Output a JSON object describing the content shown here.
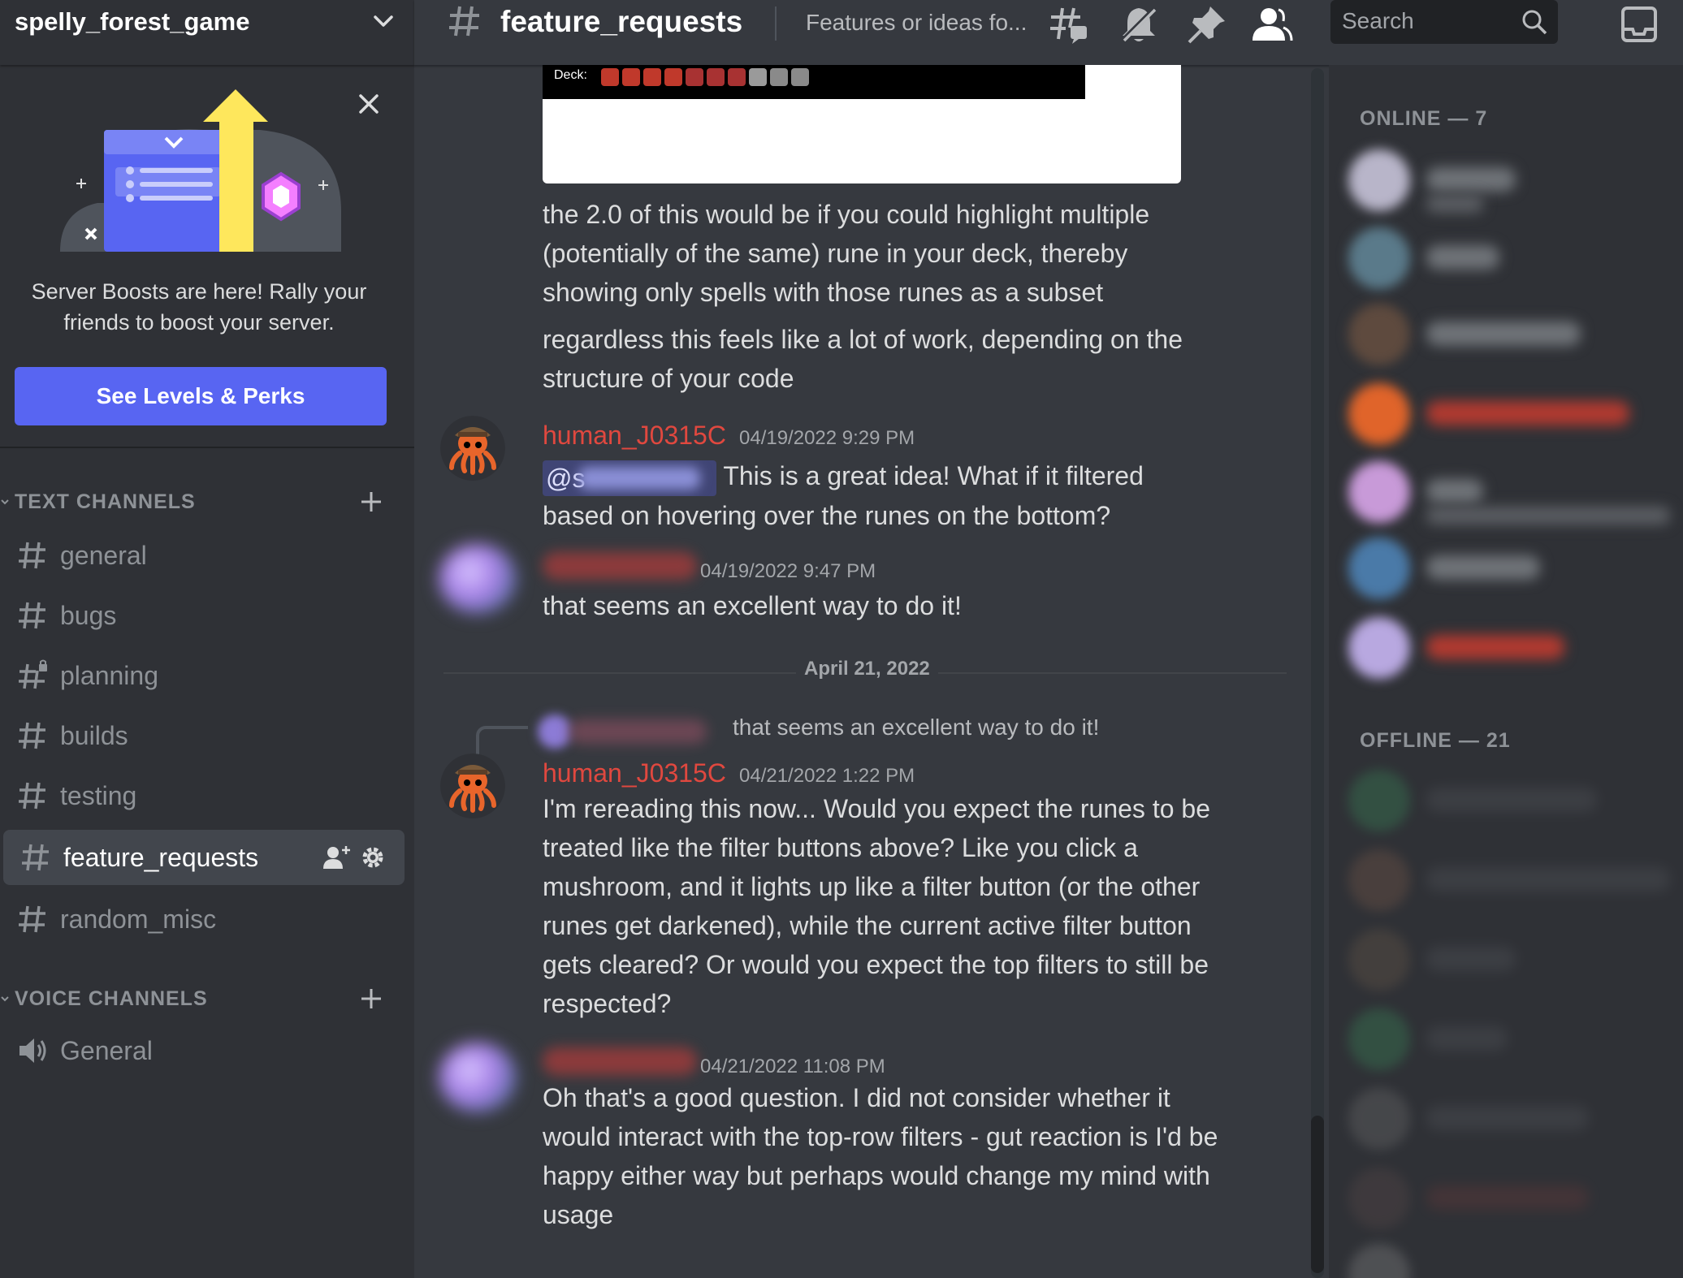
{
  "server": {
    "name": "spelly_forest_game"
  },
  "boost": {
    "text": "Server Boosts are here! Rally your friends to boost your server.",
    "button_label": "See Levels & Perks"
  },
  "categories": {
    "text": "TEXT CHANNELS",
    "voice": "VOICE CHANNELS"
  },
  "channels": [
    "general",
    "bugs",
    "planning",
    "builds",
    "testing",
    "feature_requests",
    "random_misc"
  ],
  "voice_channels": [
    "General"
  ],
  "topbar": {
    "channel": "feature_requests",
    "topic": "Features or ideas fo...",
    "search_placeholder": "Search"
  },
  "embed": {
    "deck_label": "Deck:"
  },
  "messages": {
    "cont1": "the 2.0 of this would be if you could highlight multiple (potentially of the same) rune in your deck, thereby showing only spells with those runes as a subset",
    "cont2": "regardless this feels like a lot of work, depending on the structure of your code",
    "m1": {
      "author": "human_J0315C",
      "time": "04/19/2022 9:29 PM",
      "mention_prefix": "@s",
      "text_after_mention": " This is a great idea! What if it filtered",
      "text_line2": "based on hovering over the runes on the bottom?"
    },
    "m2": {
      "time": "04/19/2022 9:47 PM",
      "text": "that seems an excellent way to do it!"
    },
    "date_divider": "April 21, 2022",
    "m3": {
      "reply_text": "that seems an excellent way to do it!",
      "author": "human_J0315C",
      "time": "04/21/2022 1:22 PM",
      "text": "I'm rereading this now... Would you expect the runes to be treated like the filter buttons above? Like you click a mushroom, and it lights up like a filter button (or the other runes get darkened), while the current active filter button gets cleared? Or would you expect the top filters to still be respected?"
    },
    "m4": {
      "time": "04/21/2022 11:08 PM",
      "text": "Oh that's a good question. I did not consider whether it would interact with the top-row filters - gut reaction is I'd be happy either way but perhaps would change my mind with usage"
    }
  },
  "members": {
    "online_header": "ONLINE — 7",
    "offline_header": "OFFLINE — 21"
  },
  "colors": {
    "accent": "#5865f2",
    "username_red": "#e0483f",
    "background": "#36393f",
    "sidebar": "#2f3136"
  }
}
